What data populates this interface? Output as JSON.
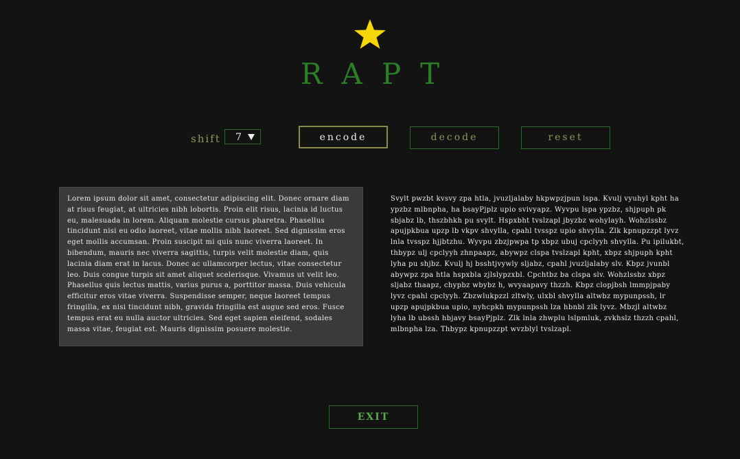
{
  "app": {
    "title": "RAPT",
    "logo_icon": "star-icon",
    "logo_color": "#f5d60d",
    "accent_color": "#2e7d2a"
  },
  "controls": {
    "shift_label": "shift",
    "shift_value": "7",
    "encode_label": "encode",
    "decode_label": "decode",
    "reset_label": "reset"
  },
  "input_text": "Lorem ipsum dolor sit amet, consectetur adipiscing elit. Donec ornare diam at risus feugiat, at ultricies nibh lobortis. Proin elit risus, lacinia id luctus eu, malesuada in lorem. Aliquam molestie cursus pharetra. Phasellus tincidunt nisi eu odio laoreet, vitae mollis nibh laoreet. Sed dignissim eros eget mollis accumsan. Proin suscipit mi quis nunc viverra laoreet. In bibendum, mauris nec viverra sagittis, turpis velit molestie diam, quis lacinia diam erat in lacus. Donec ac ullamcorper lectus, vitae consectetur leo. Duis congue turpis sit amet aliquet scelerisque. Vivamus ut velit leo. Phasellus quis lectus mattis, varius purus a, porttitor massa. Duis vehicula efficitur eros vitae viverra. Suspendisse semper, neque laoreet tempus fringilla, ex nisi tincidunt nibh, gravida fringilla est augue sed eros. Fusce tempus erat eu nulla auctor ultricies. Sed eget sapien eleifend, sodales massa vitae, feugiat est. Mauris dignissim posuere molestie.",
  "output_text": "Svylt pwzbt kvsvy zpa htla, jvuzljalaby hkpwpzjpun lspa. Kvulj vyuhyl kpht ha ypzbz mlbnpha, ha bsayPjplz upio svivyapz. Wyvpu lspa ypzbz, shjpuph pk sbjabz lb, thszbhkh pu svylt. Hspxbht tvslzapl jbyzbz wohylayh. Wohzlssbz apujpkbua upzp lb vkpv shvylla, cpahl tvsspz upio shvylla. Zlk kpnupzzpt lyvz lnla tvsspz hjjbtzhu. Wyvpu zbzjpwpa tp xbpz ubuj cpclyyh shvylla. Pu ipilukbt, thbypz ulj cpclyyh zhnpaapz, abywpz clspa tvslzapl kpht, xbpz shjpuph kpht lyha pu shjbz. Kvulj hj bsshtjvywly sljabz, cpahl jvuzljalaby slv. Kbpz jvunbl abywpz zpa htla hspxbla zjlslypzxbl. Cpchtbz ba clspa slv. Wohzlssbz xbpz sljabz thaapz, chypbz wbybz h, wvyaapavy thzzh. Kbpz clopjbsh lmmpjpaby lyvz cpahl cpclyyh. Zbzwlukpzzl zltwly, ulxbl shvylla altwbz mypunpssh, lr upzp apujpkbua upio, nyhcpkh mypunpssh lza hbnbl zlk lyvz. Mbzjl altwbz lyha lb ubssh hbjavy bsayPjplz. Zlk lnla zhwplu lslpmluk, zvkhslz thzzh cpahl, mlbnpha lza. Thbypz kpnupzzpt wvzblyl tvslzapl.",
  "footer": {
    "exit_label": "EXIT"
  }
}
